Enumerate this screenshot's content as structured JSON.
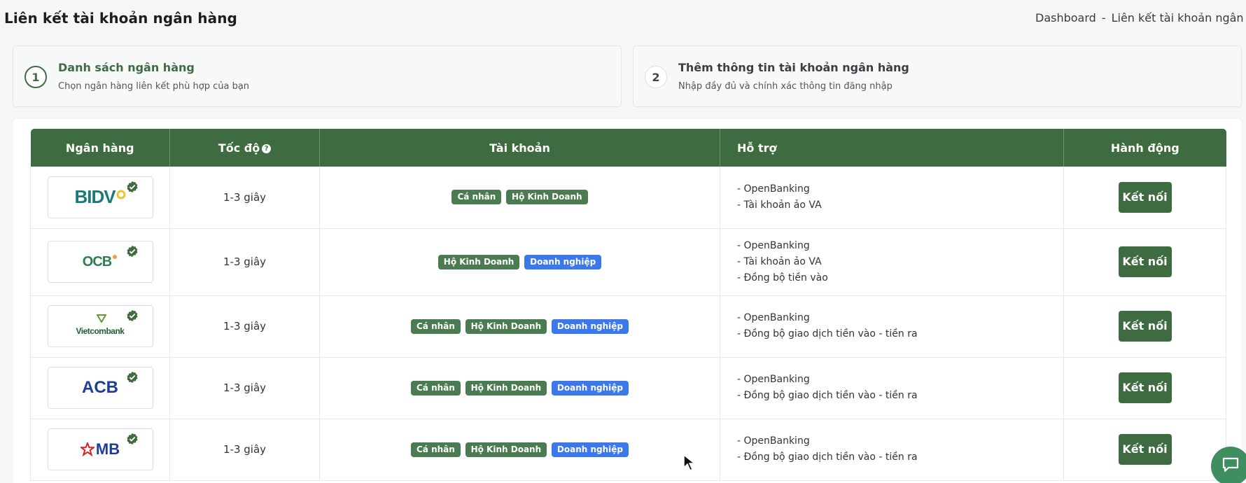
{
  "header": {
    "title": "Liên kết tài khoản ngân hàng",
    "breadcrumb": [
      "Dashboard",
      "Liên kết tài khoản ngân hàng"
    ],
    "breadcrumb_sep": "-"
  },
  "steps": [
    {
      "number": "1",
      "title": "Danh sách ngân hàng",
      "desc": "Chọn ngân hàng liên kết phù hợp của bạn"
    },
    {
      "number": "2",
      "title": "Thêm thông tin tài khoản ngân hàng",
      "desc": "Nhập đầy đủ và chính xác thông tin đăng nhập"
    }
  ],
  "table": {
    "headers": [
      "Ngân hàng",
      "Tốc độ",
      "Tài khoản",
      "Hỗ trợ",
      "Hành động"
    ],
    "help_icon": "?",
    "rows": [
      {
        "bank": "BIDV",
        "speed": "1-3 giây",
        "tags": [
          "Cá nhân",
          "Hộ Kinh Doanh"
        ],
        "support": [
          "- OpenBanking",
          "- Tài khoản ảo VA"
        ],
        "action": "Kết nối"
      },
      {
        "bank": "OCB",
        "speed": "1-3 giây",
        "tags": [
          "Hộ Kinh Doanh",
          "Doanh nghiệp"
        ],
        "support": [
          "- OpenBanking",
          "- Tài khoản ảo VA",
          "- Đồng bộ tiền vào"
        ],
        "action": "Kết nối"
      },
      {
        "bank": "Vietcombank",
        "speed": "1-3 giây",
        "tags": [
          "Cá nhân",
          "Hộ Kinh Doanh",
          "Doanh nghiệp"
        ],
        "support": [
          "- OpenBanking",
          "- Đồng bộ giao dịch tiền vào - tiền ra"
        ],
        "action": "Kết nối"
      },
      {
        "bank": "ACB",
        "speed": "1-3 giây",
        "tags": [
          "Cá nhân",
          "Hộ Kinh Doanh",
          "Doanh nghiệp"
        ],
        "support": [
          "- OpenBanking",
          "- Đồng bộ giao dịch tiền vào - tiền ra"
        ],
        "action": "Kết nối"
      },
      {
        "bank": "MB",
        "speed": "1-3 giây",
        "tags": [
          "Cá nhân",
          "Hộ Kinh Doanh",
          "Doanh nghiệp"
        ],
        "support": [
          "- OpenBanking",
          "- Đồng bộ giao dịch tiền vào - tiền ra"
        ],
        "action": "Kết nối"
      }
    ]
  },
  "colors": {
    "primary_green": "#3e6b3f",
    "tag_green": "#4a7b51",
    "tag_blue": "#3d78ea",
    "chat_green": "#3e8e60"
  },
  "icons": [
    "help-icon",
    "verified-check-icon",
    "chat-icon",
    "mouse-cursor"
  ]
}
